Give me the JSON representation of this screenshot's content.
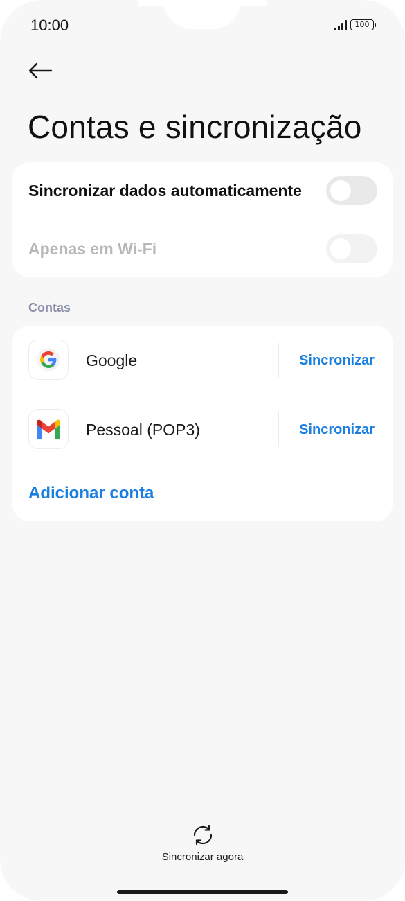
{
  "status_bar": {
    "time": "10:00",
    "battery": "100"
  },
  "header": {
    "back_icon": "arrow-left-icon",
    "title": "Contas e sincronização"
  },
  "sync_settings": {
    "auto_sync_label": "Sincronizar dados automaticamente",
    "auto_sync_on": false,
    "wifi_only_label": "Apenas em Wi-Fi",
    "wifi_only_on": false,
    "wifi_only_enabled": false
  },
  "accounts": {
    "section_title": "Contas",
    "items": [
      {
        "name": "Google",
        "icon": "google-icon",
        "action": "Sincronizar"
      },
      {
        "name": "Pessoal (POP3)",
        "icon": "gmail-icon",
        "action": "Sincronizar"
      }
    ],
    "add_label": "Adicionar conta"
  },
  "footer": {
    "sync_now_icon": "sync-icon",
    "sync_now_label": "Sincronizar agora"
  },
  "colors": {
    "accent": "#1a7fe0",
    "background": "#f7f7f7",
    "card": "#ffffff",
    "section_header": "#8a8fa8"
  }
}
